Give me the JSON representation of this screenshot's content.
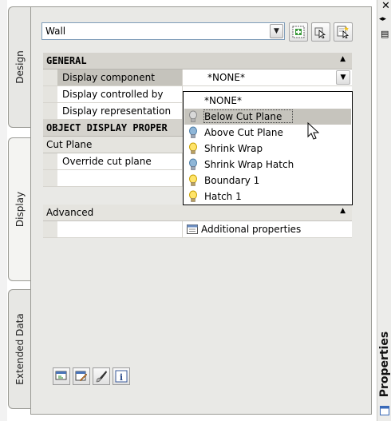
{
  "palette": {
    "title": "Properties",
    "close_glyph": "✕",
    "autohide_glyph": "◂▸",
    "menu_glyph": "▤"
  },
  "side_tabs": [
    {
      "label": "Design"
    },
    {
      "label": "Display"
    },
    {
      "label": "Extended Data"
    }
  ],
  "style_selector": {
    "value": "Wall"
  },
  "toolbar": {
    "buttons": [
      "toggle-pickadd-icon",
      "select-objects-icon",
      "quick-select-icon"
    ]
  },
  "grid": {
    "general": {
      "label": "GENERAL",
      "rows": [
        {
          "name": "Display component",
          "value": "*NONE*"
        },
        {
          "name": "Display controlled by",
          "value": ""
        },
        {
          "name": "Display representation",
          "value": ""
        }
      ]
    },
    "object_display": {
      "label": "OBJECT DISPLAY PROPER",
      "subcategory": "Cut Plane",
      "rows": [
        {
          "name": "Override cut plane",
          "value": ""
        },
        {
          "name": "",
          "value": ""
        }
      ]
    },
    "advanced": {
      "label": "Advanced",
      "rows": [
        {
          "name": "",
          "value": "Additional properties"
        }
      ]
    }
  },
  "dropdown": {
    "items": [
      {
        "label": "*NONE*",
        "icon": ""
      },
      {
        "label": "Below Cut Plane",
        "icon": "lightbulb-off-icon"
      },
      {
        "label": "Above Cut Plane",
        "icon": "lightbulb-blue-icon"
      },
      {
        "label": "Shrink Wrap",
        "icon": "lightbulb-on-icon"
      },
      {
        "label": "Shrink Wrap Hatch",
        "icon": "lightbulb-blue-icon"
      },
      {
        "label": "Boundary 1",
        "icon": "lightbulb-on-icon"
      },
      {
        "label": "Hatch 1",
        "icon": "lightbulb-on-icon"
      }
    ],
    "selected": "Below Cut Plane"
  },
  "bottom_buttons": [
    "display-manager-icon",
    "edit-display-icon",
    "brush-icon",
    "info-icon"
  ]
}
